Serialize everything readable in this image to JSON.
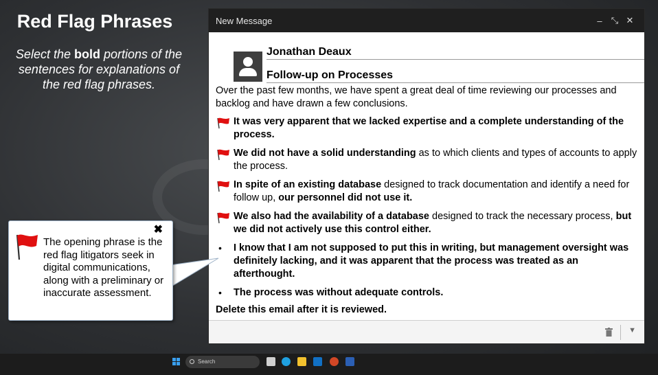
{
  "slide": {
    "title": "Red Flag Phrases",
    "instructions": {
      "part1": "Select the ",
      "bold": "bold",
      "part2": " portions of the sentences for explanations of the red flag phrases."
    }
  },
  "window": {
    "title": "New Message",
    "controls": {
      "minimize": "–",
      "restore": "⤡",
      "close": "✕"
    }
  },
  "email": {
    "from": "Jonathan Deaux",
    "subject": "Follow-up on Processes",
    "intro": "Over the past few months, we have spent a great deal of time reviewing our processes and backlog and have drawn a few conclusions.",
    "items": [
      {
        "flag": true,
        "b1": "It was very apparent that we lacked expertise and a complete understanding of the process.",
        "t1": "",
        "b2": ""
      },
      {
        "flag": true,
        "b1": "We did not have a solid understanding",
        "t1": " as to which clients and types of accounts to apply the process.",
        "b2": ""
      },
      {
        "flag": true,
        "b1": "In spite of an existing database",
        "t1": " designed to track documentation and identify a need for follow up, ",
        "b2": "our personnel did not use it."
      },
      {
        "flag": true,
        "b1": "We also had the availability of a database",
        "t1": " designed to track the necessary process, ",
        "b2": "but we did not actively use this control either."
      },
      {
        "flag": false,
        "b1": "I know that I am not supposed to put this in writing, but management oversight was definitely lacking, and it was apparent that the process was treated as an afterthought.",
        "t1": "",
        "b2": ""
      },
      {
        "flag": false,
        "b1": "The process was without adequate controls.",
        "t1": "",
        "b2": ""
      }
    ],
    "bullet_char": "•",
    "closing": "Delete this email after it is reviewed."
  },
  "callout": {
    "close": "✖",
    "text": "The opening phrase is the red flag litigators seek in digital communications, along with a preliminary or inaccurate assessment."
  },
  "taskbar": {
    "search_placeholder": "Search",
    "icons": [
      "task-view-icon",
      "edge-icon",
      "file-explorer-icon",
      "outlook-icon",
      "powerpoint-icon",
      "word-icon"
    ]
  },
  "colors": {
    "flag_red": "#e01010",
    "titlebar": "#1f1f1f"
  }
}
